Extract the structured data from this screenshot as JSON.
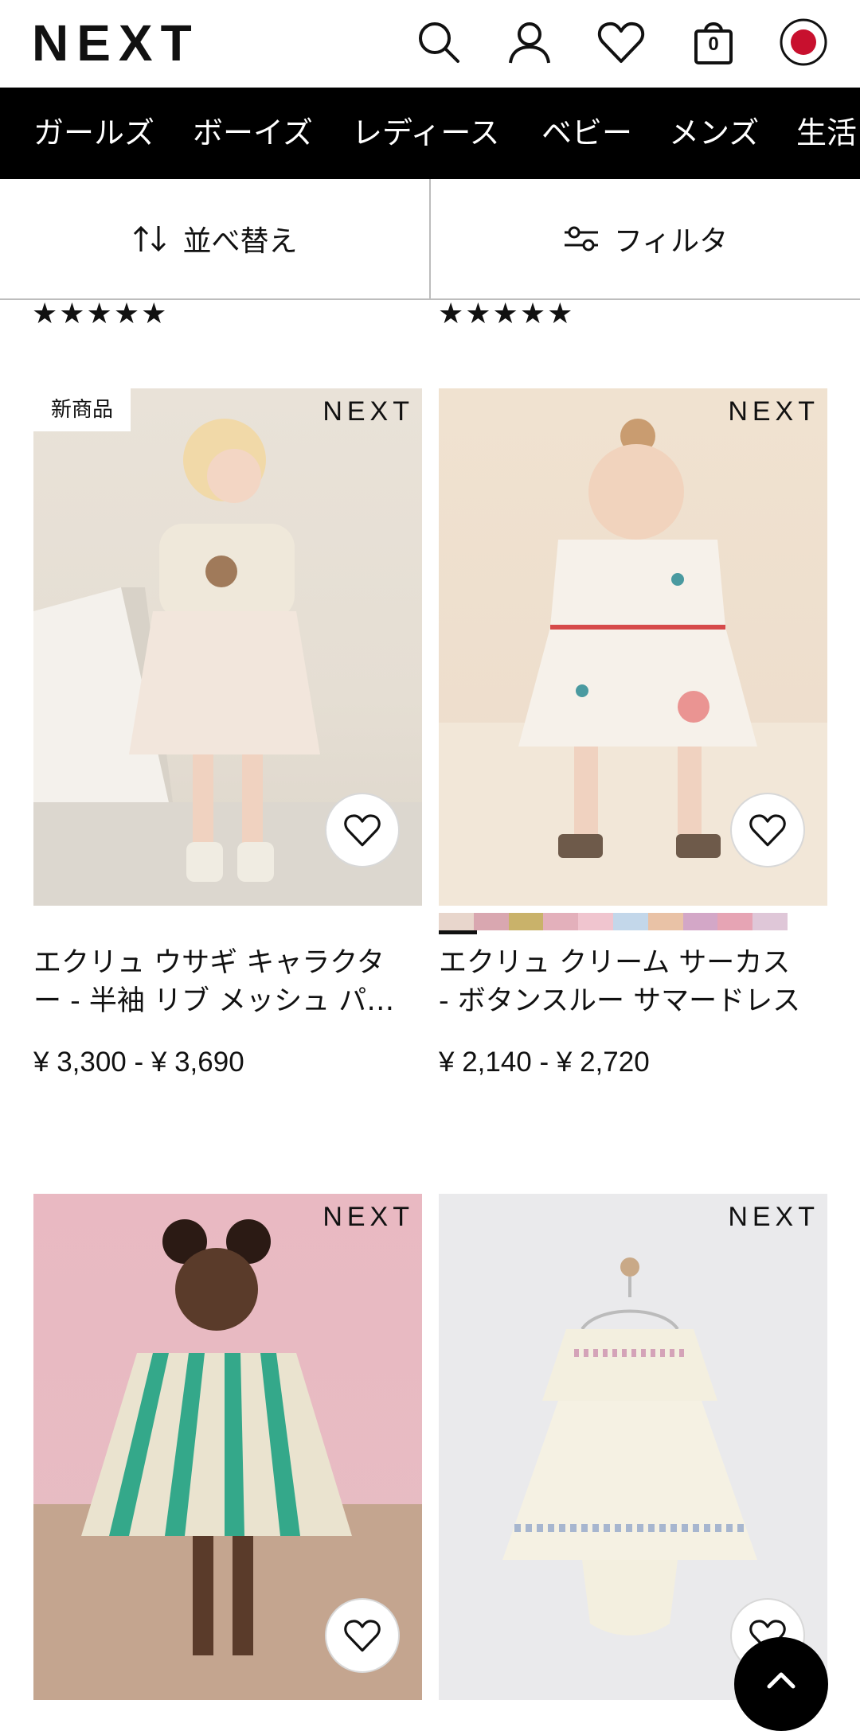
{
  "header": {
    "logo": "NEXT",
    "icons": [
      "search-icon",
      "account-icon",
      "heart-icon",
      "bag-icon",
      "japan-flag-icon"
    ],
    "bag_count": "0"
  },
  "category_nav": {
    "items": [
      "ガールズ",
      "ボーイズ",
      "レディース",
      "ベビー",
      "メンズ",
      "生活"
    ]
  },
  "toolbar": {
    "sort_label": "並べ替え",
    "filter_label": "フィルタ"
  },
  "stars": {
    "left": "★★★★★",
    "right": "★★★★★",
    "left_rating": 5,
    "right_rating": 5
  },
  "products": [
    {
      "brand": "NEXT",
      "badge": "新商品",
      "title_line1": "エクリュ ウサギ キャラクタ",
      "title_line2": "ー - 半袖 リブ メッシュ パーティーワンピース",
      "price": "¥ 3,300 - ¥ 3,690",
      "image_desc": "toddler-bunny-dress-photo"
    },
    {
      "brand": "NEXT",
      "badge": "",
      "title_line1": "エクリュ クリーム サーカス",
      "title_line2": "- ボタンスルー サマードレス",
      "price": "¥ 2,140 - ¥ 2,720",
      "image_desc": "toddler-circus-dress-photo"
    },
    {
      "brand": "NEXT",
      "badge": "",
      "title_line1": "",
      "title_line2": "",
      "price": "",
      "image_desc": "green-stripe-dress-photo"
    },
    {
      "brand": "NEXT",
      "badge": "",
      "title_line1": "",
      "title_line2": "",
      "price": "",
      "image_desc": "embroidered-baby-dress-photo"
    }
  ],
  "colors": {
    "nav_bg": "#000000",
    "accent_red": "#c8102e",
    "divider": "#bdbdbd"
  }
}
